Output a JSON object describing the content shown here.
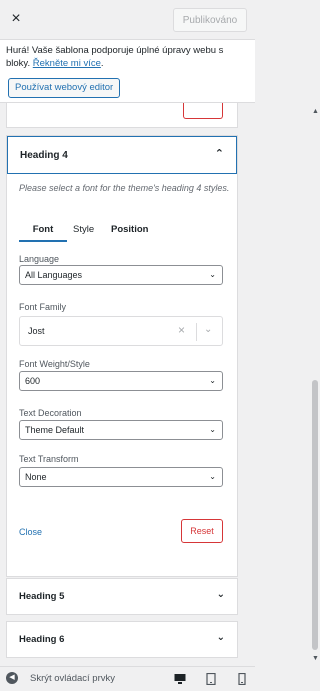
{
  "header": {
    "close_label": "×",
    "publish_label": "Publikováno"
  },
  "notice": {
    "text": "Hurá! Vaše šablona podporuje úplné úpravy webu s bloky.",
    "link": "Řekněte mi více",
    "link_suffix": ".",
    "button": "Používat webový editor"
  },
  "panel": {
    "title": "Heading 4",
    "description": "Please select a font for the theme's heading 4 styles.",
    "tabs": [
      "Font",
      "Style",
      "Position"
    ],
    "language": {
      "label": "Language",
      "value": "All Languages"
    },
    "font_family": {
      "label": "Font Family",
      "value": "Jost"
    },
    "font_weight": {
      "label": "Font Weight/Style",
      "value": "600"
    },
    "text_decoration": {
      "label": "Text Decoration",
      "value": "Theme Default"
    },
    "text_transform": {
      "label": "Text Transform",
      "value": "None"
    },
    "close_label": "Close",
    "reset_label": "Reset"
  },
  "collapsed_sections": [
    "Heading 5",
    "Heading 6"
  ],
  "footer": {
    "hide_controls": "Skrýt ovládací prvky"
  },
  "colors": {
    "accent": "#2271b1",
    "danger": "#d63638"
  }
}
